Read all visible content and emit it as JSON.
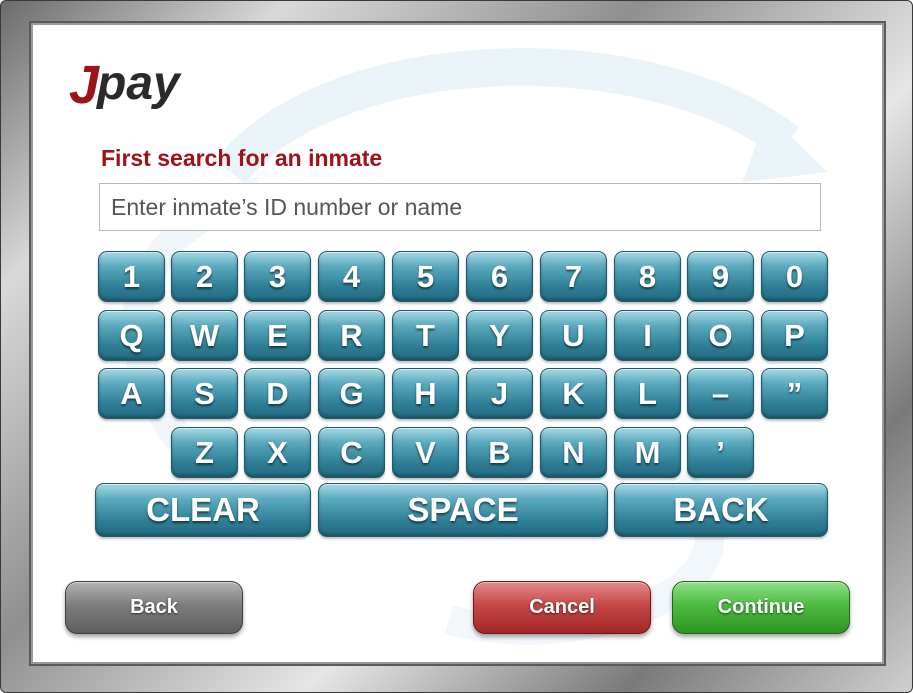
{
  "brand": {
    "logo_text_j": "J",
    "logo_text_rest": "pay"
  },
  "search": {
    "heading": "First search for an inmate",
    "placeholder": "Enter inmate’s ID number or name",
    "value": ""
  },
  "keyboard": {
    "row1": [
      "1",
      "2",
      "3",
      "4",
      "5",
      "6",
      "7",
      "8",
      "9",
      "0"
    ],
    "row2": [
      "Q",
      "W",
      "E",
      "R",
      "T",
      "Y",
      "U",
      "I",
      "O",
      "P"
    ],
    "row3": [
      "A",
      "S",
      "D",
      "G",
      "H",
      "J",
      "K",
      "L",
      "–",
      "”"
    ],
    "row4": [
      "Z",
      "X",
      "C",
      "V",
      "B",
      "N",
      "M",
      "’"
    ],
    "clear_label": "CLEAR",
    "space_label": "SPACE",
    "back_label": "BACK"
  },
  "nav": {
    "back_label": "Back",
    "cancel_label": "Cancel",
    "continue_label": "Continue"
  },
  "colors": {
    "heading_red": "#a0121a",
    "key_teal": "#2f7f97",
    "cancel_red": "#c64747",
    "continue_green": "#4cbc40",
    "back_gray": "#7d7d7d"
  }
}
